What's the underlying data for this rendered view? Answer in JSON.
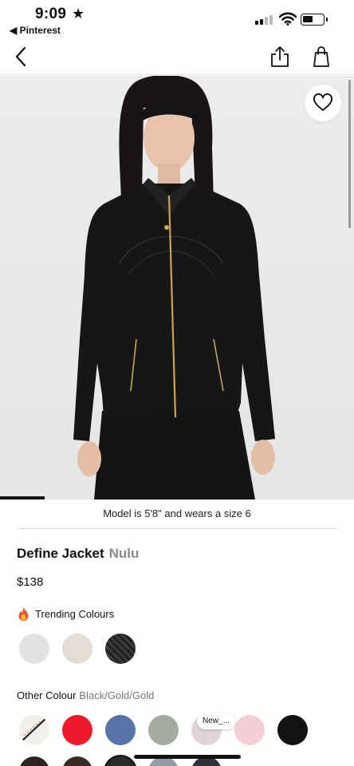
{
  "status_bar": {
    "time": "9:09",
    "back_app": "◀ Pinterest"
  },
  "product": {
    "model_note": "Model is 5'8\" and wears a size 6",
    "name": "Define Jacket",
    "fabric": "Nulu",
    "price": "$138",
    "trending_label": "Trending Colours",
    "trending_colours": [
      "#e2e2e2",
      "#e3ddd5",
      "#2a2a2a"
    ],
    "other_colour_label": "Other Colour",
    "other_colour_value": "Black/Gold/Gold",
    "other_colours": [
      "pattern-stripe",
      "#ee1a2c",
      "#5873a8",
      "#a6aba2",
      "#e0d4da",
      "#f4cfd6",
      "#121212"
    ],
    "new_tag": "New_..."
  },
  "icons": {
    "nav": [
      "chevron-left-icon",
      "share-icon",
      "shopping-bag-icon"
    ],
    "favorite": "heart-icon",
    "trending": "fire-icon"
  }
}
